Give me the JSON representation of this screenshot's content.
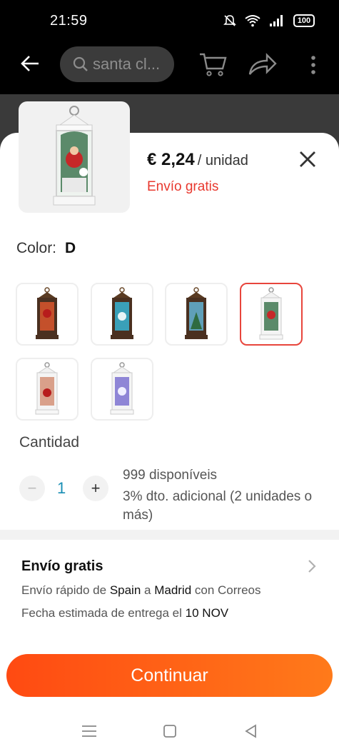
{
  "status": {
    "time": "21:59",
    "battery": "100"
  },
  "search": {
    "placeholder": "santa cl..."
  },
  "product": {
    "price": "€ 2,24",
    "unit": "/ unidad",
    "shipping": "Envío gratis"
  },
  "color": {
    "label": "Color:",
    "selected": "D"
  },
  "quantity": {
    "label": "Cantidad",
    "minus": "−",
    "value": "1",
    "plus": "+",
    "available": "999 disponíveis",
    "discount": "3% dto. adicional (2 unidades o más)"
  },
  "shipping_section": {
    "title": "Envío gratis",
    "line1_a": "Envío rápido de ",
    "from": "Spain",
    "line1_b": " a ",
    "to": "Madrid",
    "line1_c": " con Correos",
    "line2_a": "Fecha estimada de entrega el ",
    "date": "10 NOV"
  },
  "cta": {
    "continue": "Continuar"
  },
  "colors": {
    "accent": "#e8382e",
    "cta_start": "#ff4a12",
    "cta_end": "#ff7a1a",
    "qty": "#1a8fb5"
  }
}
